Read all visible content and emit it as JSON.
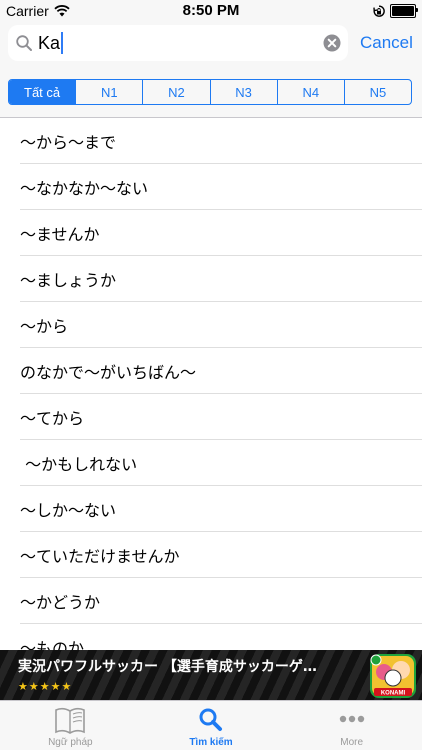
{
  "status_bar": {
    "carrier": "Carrier",
    "time": "8:50 PM",
    "battery_level": 1.0
  },
  "search": {
    "query": "Ka",
    "cancel_label": "Cancel",
    "icons": {
      "search": "search-icon",
      "clear": "clear-icon"
    }
  },
  "filters": {
    "items": [
      "Tất cả",
      "N1",
      "N2",
      "N3",
      "N4",
      "N5"
    ],
    "selected": "Tất cả"
  },
  "list": {
    "items": [
      "～から～まで",
      "～なかなか～ない",
      "～ませんか",
      "～ましょうか",
      "～から",
      "のなかで～がいちばん～",
      "～てから",
      " ～かもしれない",
      "～しか～ない",
      "～ていただけませんか",
      "～かどうか",
      "～ものか"
    ]
  },
  "ad": {
    "title": "実況パワフルサッカー 【選手育成サッカーゲ…",
    "rating": "★★★★★",
    "rating_value": 4.5,
    "icon": "konami-app-icon",
    "icon_text": "KONAMI"
  },
  "tab_bar": {
    "tabs": [
      {
        "label": "Ngữ pháp",
        "icon": "book-icon"
      },
      {
        "label": "Tìm kiếm",
        "icon": "search-icon"
      },
      {
        "label": "More",
        "icon": "more-icon"
      }
    ],
    "active": "Tìm kiếm"
  },
  "colors": {
    "accent": "#1e7af2",
    "bar_background": "#f7f7f7",
    "inactive": "#9b9b9b"
  }
}
